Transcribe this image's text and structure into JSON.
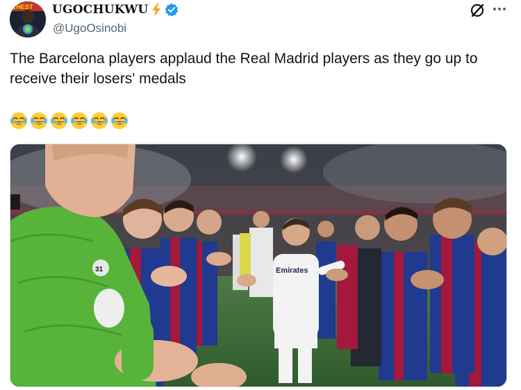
{
  "author": {
    "display_name": "UGOCHUKWU",
    "handle": "@UgoOsinobi",
    "badge_icons": [
      "lightning-bolt-icon",
      "verified-badge-icon"
    ],
    "verified_color": "#1d9bf0"
  },
  "header_actions": {
    "grok_icon": "grok-icon",
    "more_icon": "more-options-icon"
  },
  "tweet": {
    "text": "The Barcelona players applaud the Real Madrid players as they go up to receive their losers' medals",
    "emoji_icon": "face-with-tears-of-joy-icon",
    "emoji_count": 6
  },
  "media": {
    "type": "photo",
    "jersey_text": "Emirates",
    "colors": {
      "barca_blue": "#1f3a8f",
      "barca_red": "#a3183c",
      "madrid_white": "#f3f3f3",
      "keeper_green": "#58b33a",
      "pitch": "#3d6b3a"
    }
  }
}
